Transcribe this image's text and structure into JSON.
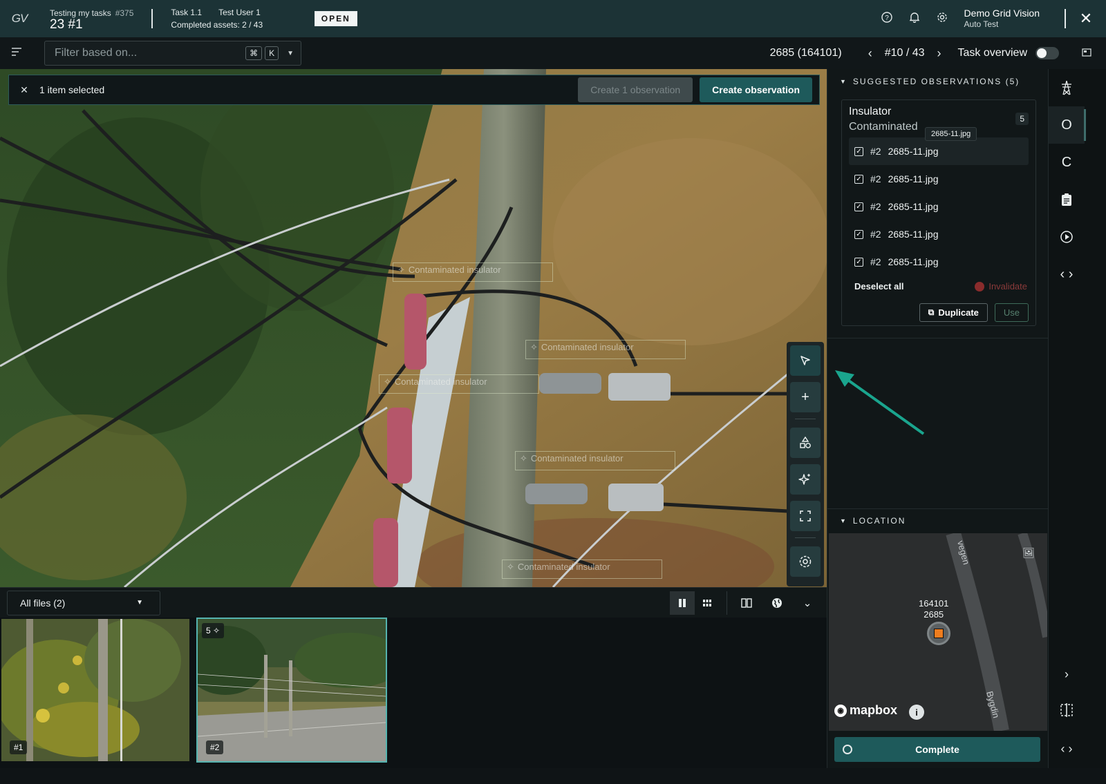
{
  "header": {
    "logo": "GV",
    "project_name": "Testing my tasks",
    "project_id": "#375",
    "task_number": "23 #1",
    "task_name": "Task 1.1",
    "assignee": "Test User 1",
    "completed_assets": "Completed assets: 2 / 43",
    "status_badge": "OPEN",
    "org_name": "Demo Grid Vision",
    "user_role": "Auto Test"
  },
  "toolbar": {
    "filter_placeholder": "Filter based on...",
    "shortcut_cmd": "⌘",
    "shortcut_key": "K",
    "asset_id": "2685 (164101)",
    "asset_position": "#10 / 43",
    "task_overview_label": "Task overview"
  },
  "viewer": {
    "selection_text": "1 item selected",
    "create_one_label": "Create 1 observation",
    "create_label": "Create observation",
    "annotations": [
      "Contaminated insulator",
      "Contaminated insulator",
      "Contaminated insulator",
      "Contaminated insulator",
      "Contaminated insulator"
    ]
  },
  "filmstrip": {
    "file_filter": "All files (2)",
    "thumbs": [
      {
        "label": "#1"
      },
      {
        "label": "#2",
        "badge": "5"
      }
    ]
  },
  "panel": {
    "suggested_header": "SUGGESTED OBSERVATIONS (5)",
    "obs_title": "Insulator",
    "obs_subtitle": "Contaminated",
    "obs_count": "5",
    "tooltip": "2685-11.jpg",
    "files": [
      {
        "num": "#2",
        "name": "2685-11.jpg"
      },
      {
        "num": "#2",
        "name": "2685-11.jpg"
      },
      {
        "num": "#2",
        "name": "2685-11.jpg"
      },
      {
        "num": "#2",
        "name": "2685-11.jpg"
      },
      {
        "num": "#2",
        "name": "2685-11.jpg"
      }
    ],
    "deselect_label": "Deselect all",
    "invalidate_label": "Invalidate",
    "duplicate_label": "Duplicate",
    "use_label": "Use",
    "location_header": "LOCATION",
    "map_label_line1": "164101",
    "map_label_line2": "2685",
    "map_road_1": "vegen",
    "map_road_2": "Bygdin",
    "map_attribution": "mapbox",
    "complete_label": "Complete"
  },
  "rail": {
    "items": [
      "tower-icon",
      "O",
      "C",
      "clipboard-icon",
      "history-icon",
      "code-icon"
    ]
  },
  "colors": {
    "header_bg": "#1c3336",
    "accent": "#1e5a5b",
    "marker": "#f07d1e",
    "annotation_arrow": "#1aa58e"
  }
}
